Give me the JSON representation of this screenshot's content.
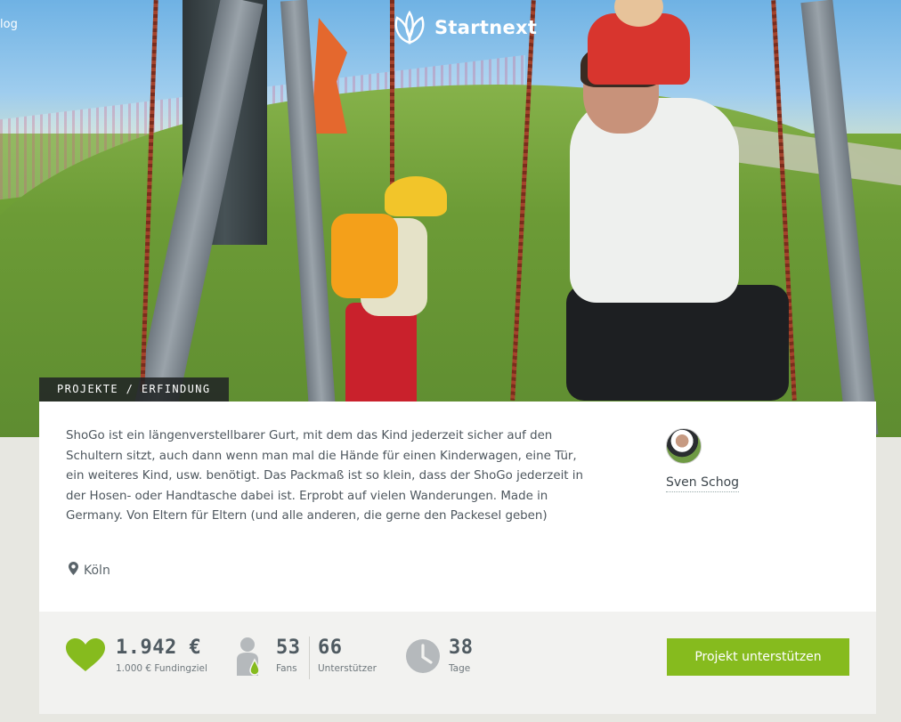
{
  "header": {
    "logo_text": "Startnext",
    "corner_link": "log"
  },
  "breadcrumb": "PROJEKTE / ERFINDUNG",
  "project": {
    "description": "ShoGo ist ein längenverstellbarer Gurt, mit dem das Kind jederzeit sicher auf den Schultern sitzt, auch dann wenn man mal die Hände für einen Kinderwagen, eine Tür, ein weiteres Kind, usw. benötigt. Das Packmaß ist so klein, dass der ShoGo jederzeit in der Hosen- oder Handtasche dabei ist. Erprobt auf vielen Wanderungen. Made in Germany. Von Eltern für Eltern (und alle anderen, die gerne den Packesel geben)",
    "location": "Köln",
    "author": "Sven Schog"
  },
  "stats": {
    "funding_amount": "1.942 €",
    "funding_goal": "1.000 € Fundingziel",
    "fans_count": "53",
    "fans_label": "Fans",
    "supporters_count": "66",
    "supporters_label": "Unterstützer",
    "days_count": "38",
    "days_label": "Tage"
  },
  "cta": {
    "support_label": "Projekt unterstützen"
  },
  "colors": {
    "accent_green": "#86bb1e",
    "stat_gray": "#4f5a61"
  },
  "icons": [
    "logo-leaf-icon",
    "map-pin-icon",
    "heart-icon",
    "fan-person-icon",
    "clock-icon"
  ]
}
